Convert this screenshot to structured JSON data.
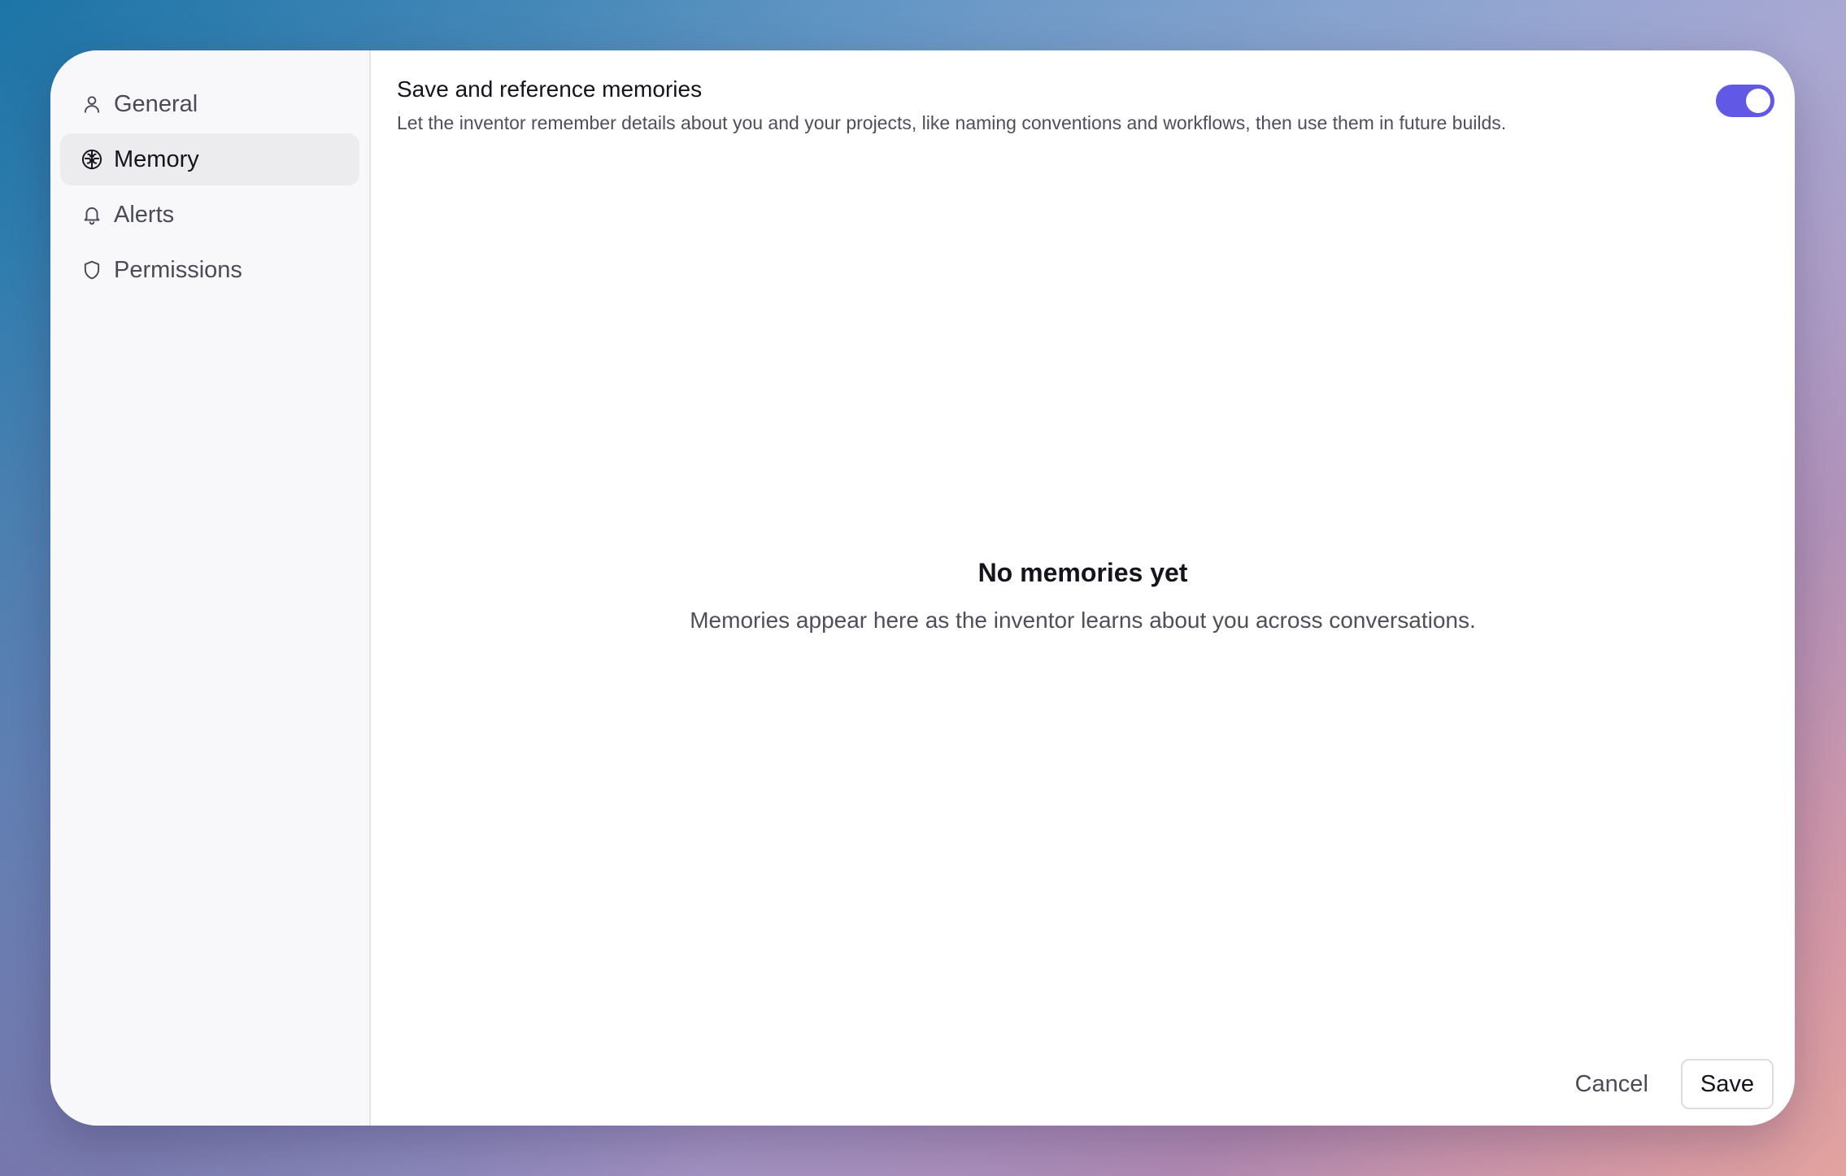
{
  "sidebar": {
    "items": [
      {
        "label": "General",
        "icon": "user-icon",
        "active": false
      },
      {
        "label": "Memory",
        "icon": "brain-icon",
        "active": true
      },
      {
        "label": "Alerts",
        "icon": "bell-icon",
        "active": false
      },
      {
        "label": "Permissions",
        "icon": "shield-icon",
        "active": false
      }
    ]
  },
  "setting": {
    "title": "Save and reference memories",
    "description": "Let the inventor remember details about you and your projects, like naming conventions and workflows, then use them in future builds.",
    "toggle_on": true,
    "toggle_color": "#6159e6"
  },
  "empty_state": {
    "title": "No memories yet",
    "text": "Memories appear here as the inventor learns about you across conversations."
  },
  "footer": {
    "cancel_label": "Cancel",
    "save_label": "Save"
  }
}
